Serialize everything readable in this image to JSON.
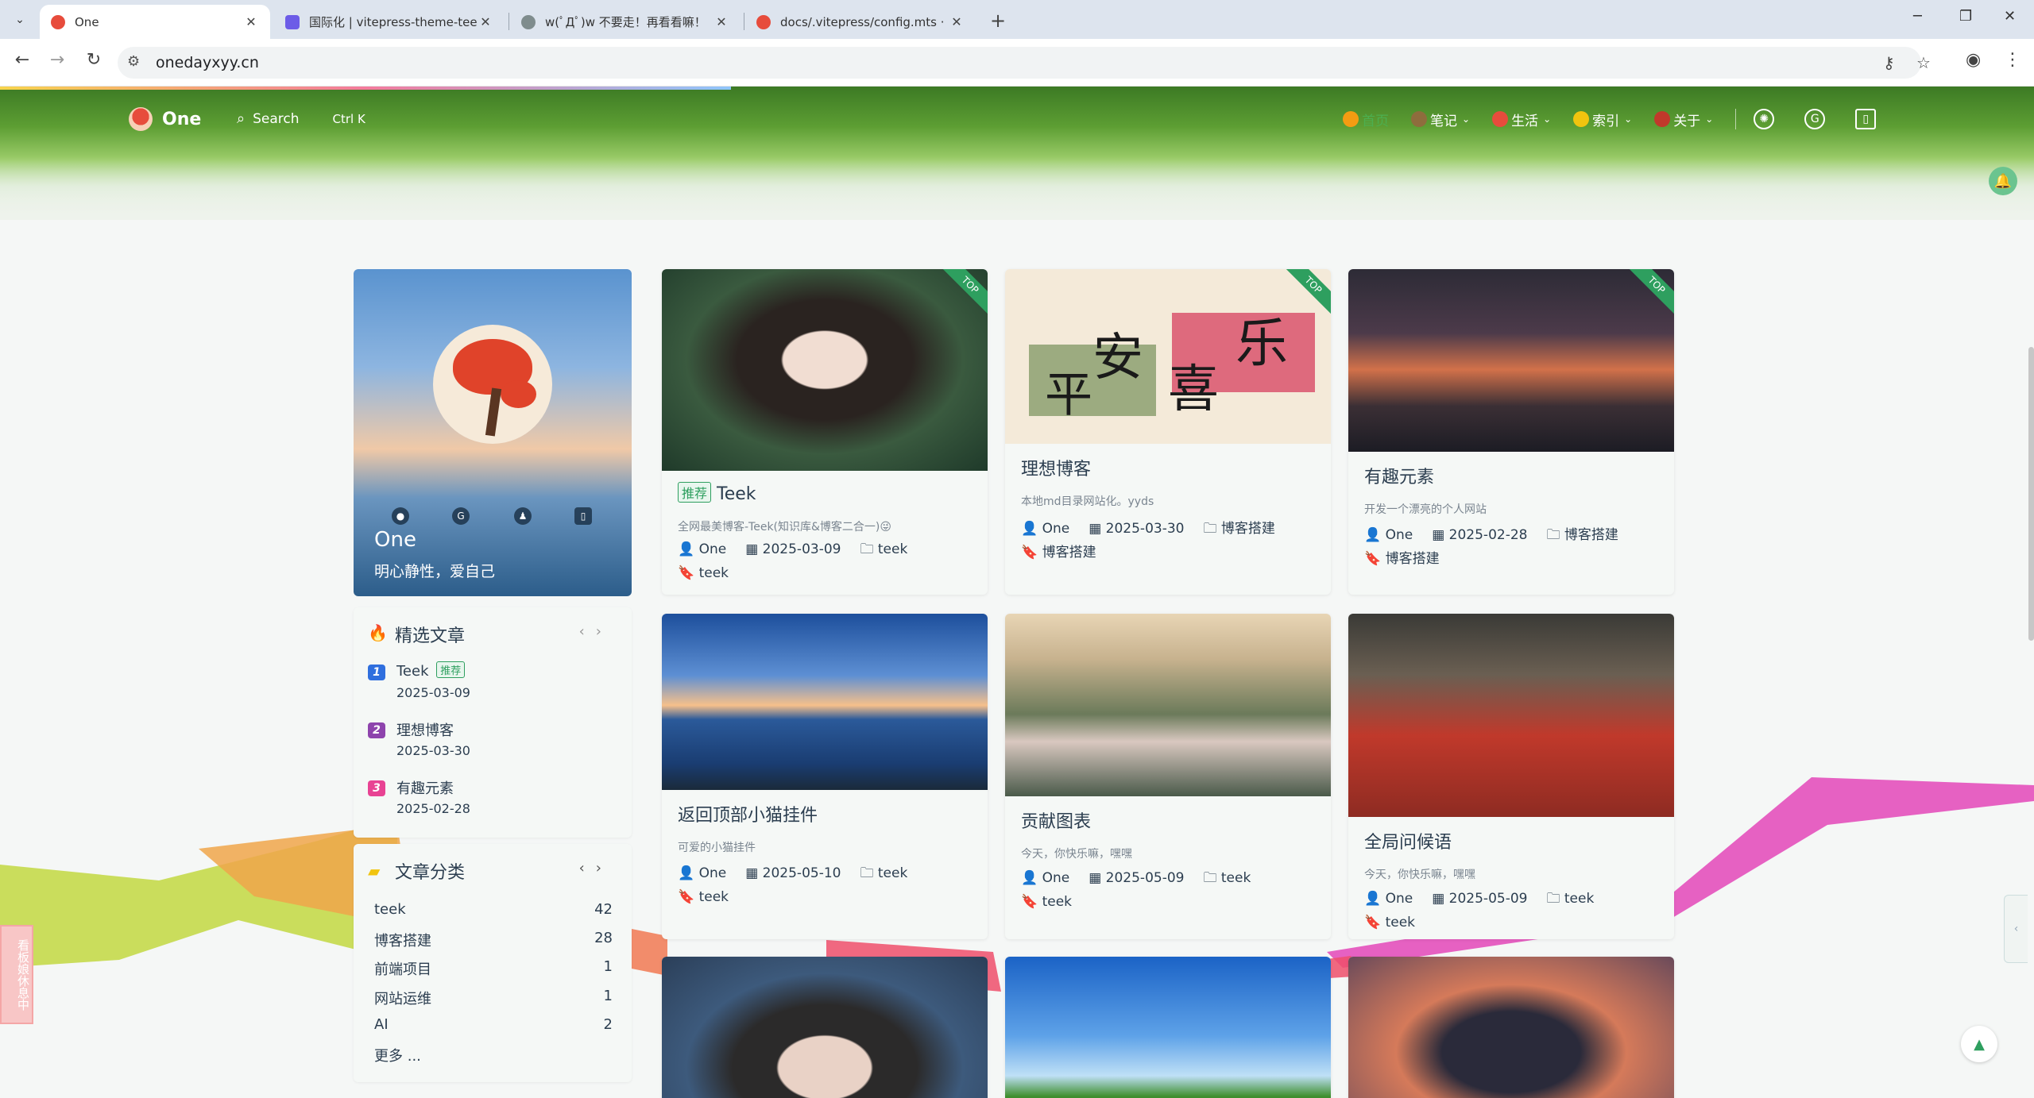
{
  "browser": {
    "tabs": [
      {
        "title": "One",
        "fav": "#e74c3c"
      },
      {
        "title": "国际化 | vitepress-theme-teek",
        "fav": "#6c5ce7"
      },
      {
        "title": "w(ﾟДﾟ)w 不要走！再看看嘛！",
        "fav": "#7f8c8d"
      },
      {
        "title": "docs/.vitepress/config.mts · ",
        "fav": "#e74c3c"
      }
    ],
    "url": "onedayxyy.cn"
  },
  "site": {
    "logo_name": "One",
    "search_label": "Search",
    "search_shortcut": "Ctrl K",
    "nav": [
      {
        "label": "首页",
        "icon": "#f39c12",
        "active": true,
        "dropdown": false
      },
      {
        "label": "笔记",
        "icon": "#8e6d3d",
        "active": false,
        "dropdown": true
      },
      {
        "label": "生活",
        "icon": "#e74c3c",
        "active": false,
        "dropdown": true
      },
      {
        "label": "索引",
        "icon": "#f1c40f",
        "active": false,
        "dropdown": true
      },
      {
        "label": "关于",
        "icon": "#c0392b",
        "active": false,
        "dropdown": true
      }
    ]
  },
  "profile": {
    "name": "One",
    "motto": "明心静性，爱自己"
  },
  "featured": {
    "title": "精选文章",
    "items": [
      {
        "num": "1",
        "title": "Teek",
        "badge": "推荐",
        "date": "2025-03-09",
        "color": "#2f6fde"
      },
      {
        "num": "2",
        "title": "理想博客",
        "badge": "",
        "date": "2025-03-30",
        "color": "#8e44ad"
      },
      {
        "num": "3",
        "title": "有趣元素",
        "badge": "",
        "date": "2025-02-28",
        "color": "#e84393"
      }
    ]
  },
  "categories": {
    "title": "文章分类",
    "items": [
      {
        "name": "teek",
        "count": "42"
      },
      {
        "name": "博客搭建",
        "count": "28"
      },
      {
        "name": "前端项目",
        "count": "1"
      },
      {
        "name": "网站运维",
        "count": "1"
      },
      {
        "name": "AI",
        "count": "2"
      }
    ],
    "more": "更多 ..."
  },
  "articles": [
    {
      "title": "Teek",
      "badge": "推荐",
      "desc": "全网最美博客-Teek(知识库&博客二合一)😜",
      "author": "One",
      "date": "2025-03-09",
      "category": "teek",
      "tag": "teek",
      "top": "TOP"
    },
    {
      "title": "理想博客",
      "badge": "",
      "desc": "本地md目录网站化。yyds",
      "author": "One",
      "date": "2025-03-30",
      "category": "博客搭建",
      "tag": "博客搭建",
      "top": "TOP"
    },
    {
      "title": "有趣元素",
      "badge": "",
      "desc": "开发一个漂亮的个人网站",
      "author": "One",
      "date": "2025-02-28",
      "category": "博客搭建",
      "tag": "博客搭建",
      "top": "TOP"
    },
    {
      "title": "返回顶部小猫挂件",
      "badge": "",
      "desc": "可爱的小猫挂件",
      "author": "One",
      "date": "2025-05-10",
      "category": "teek",
      "tag": "teek",
      "top": ""
    },
    {
      "title": "贡献图表",
      "badge": "",
      "desc": "今天，你快乐嘛，嘿嘿",
      "author": "One",
      "date": "2025-05-09",
      "category": "teek",
      "tag": "teek",
      "top": ""
    },
    {
      "title": "全局问候语",
      "badge": "",
      "desc": "今天，你快乐嘛，嘿嘿",
      "author": "One",
      "date": "2025-05-09",
      "category": "teek",
      "tag": "teek",
      "top": ""
    }
  ],
  "poster_text": {
    "left1": "平",
    "left2": "安",
    "right1": "喜",
    "right2": "乐"
  },
  "side_float_text": "看板娘休息中"
}
